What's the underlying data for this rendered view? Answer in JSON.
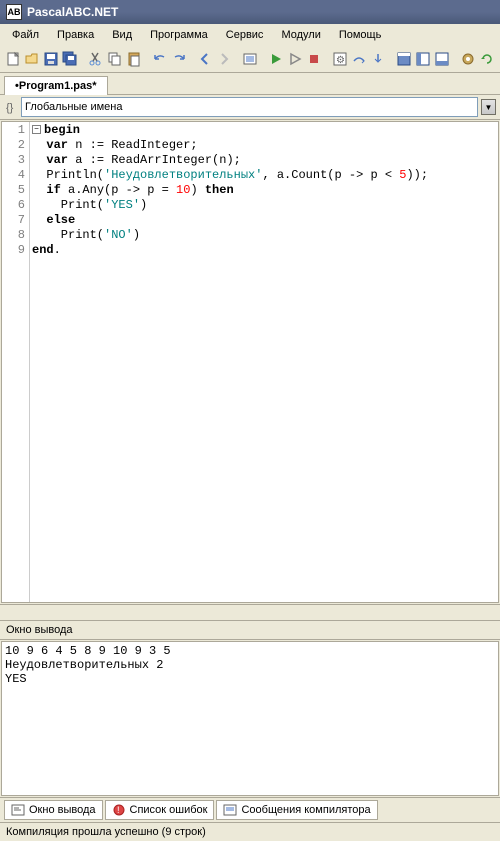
{
  "app": {
    "title": "PascalABC.NET"
  },
  "menu": {
    "file": "Файл",
    "edit": "Правка",
    "view": "Вид",
    "program": "Программа",
    "service": "Сервис",
    "modules": "Модули",
    "help": "Помощь"
  },
  "tab": {
    "name": "•Program1.pas*"
  },
  "scope": {
    "label": "Глобальные имена"
  },
  "code": {
    "lines": {
      "1": "begin",
      "2": "var",
      "2b": " n := ReadInteger;",
      "3": "var",
      "3b": " a := ReadArrInteger(n);",
      "4a": "  Println(",
      "4s": "'Неудовлетворительных'",
      "4b": ", a.Count(p -> p < ",
      "4n": "5",
      "4c": "));",
      "5a": "if",
      "5b": " a.Any(p -> p = ",
      "5n": "10",
      "5c": ") ",
      "5d": "then",
      "6a": "    Print(",
      "6s": "'YES'",
      "6b": ")",
      "7": "else",
      "8a": "    Print(",
      "8s": "'NO'",
      "8b": ")",
      "9": "end",
      "9b": "."
    },
    "linenumbers": [
      "1",
      "2",
      "3",
      "4",
      "5",
      "6",
      "7",
      "8",
      "9"
    ]
  },
  "output": {
    "header": "Окно вывода",
    "text": "10 9 6 4 5 8 9 10 9 3 5\nНеудовлетворительных 2\nYES"
  },
  "bottom_tabs": {
    "output": "Окно вывода",
    "errors": "Список ошибок",
    "compiler": "Сообщения компилятора"
  },
  "status": {
    "text": "Компиляция прошла успешно (9 строк)"
  }
}
